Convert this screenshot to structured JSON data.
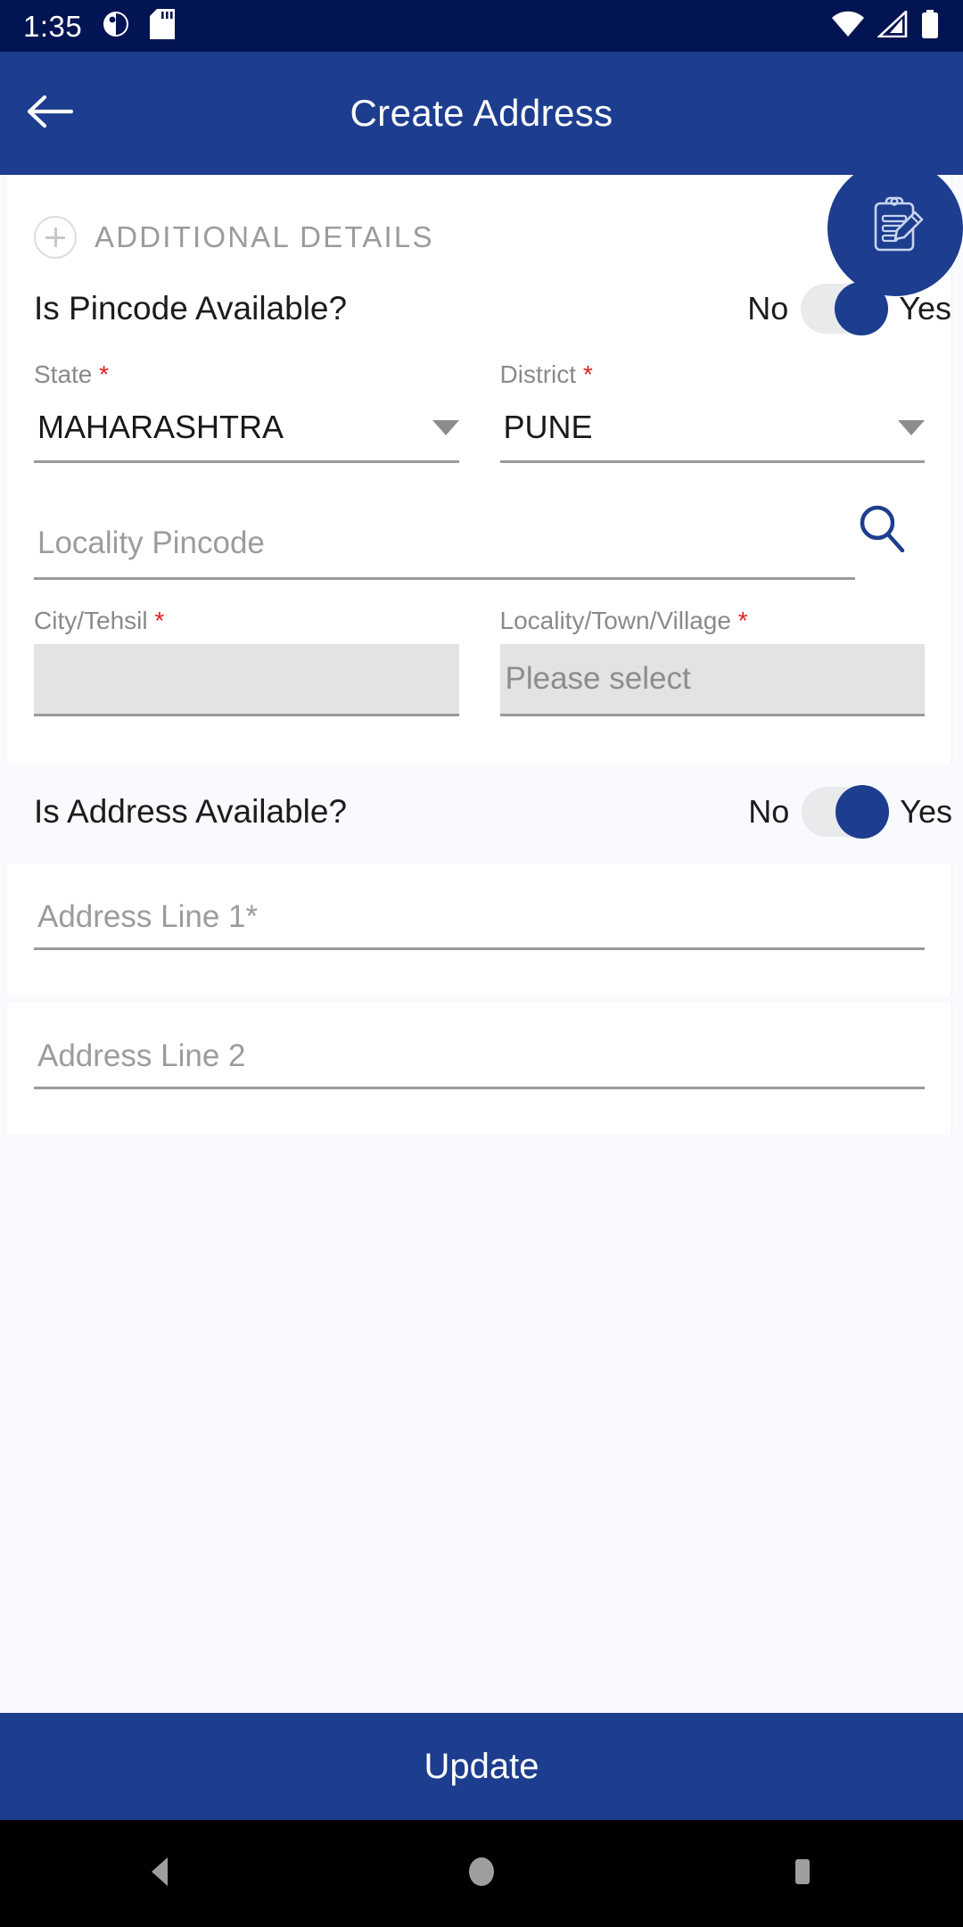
{
  "status_bar": {
    "time": "1:35",
    "icons": [
      "screenshot-icon",
      "sd-card-icon",
      "wifi-icon",
      "cellular-signal-icon",
      "battery-icon"
    ]
  },
  "app_bar": {
    "back_icon": "back-arrow-icon",
    "title": "Create Address"
  },
  "fab": {
    "icon": "clipboard-edit-icon"
  },
  "section": {
    "expand_icon": "plus-circle-icon",
    "title": "ADDITIONAL DETAILS"
  },
  "pincode_toggle": {
    "label": "Is Pincode Available?",
    "off_label": "No",
    "on_label": "Yes",
    "value": "Yes"
  },
  "state": {
    "label": "State",
    "required": "*",
    "value": "MAHARASHTRA",
    "caret_icon": "chevron-down-icon"
  },
  "district": {
    "label": "District",
    "required": "*",
    "value": "PUNE",
    "caret_icon": "chevron-down-icon"
  },
  "locality_pincode": {
    "placeholder": "Locality Pincode",
    "value": "",
    "search_icon": "search-icon"
  },
  "city_tehsil": {
    "label": "City/Tehsil",
    "required": "*",
    "value": ""
  },
  "locality_town_village": {
    "label": "Locality/Town/Village",
    "required": "*",
    "value": "Please select"
  },
  "address_toggle": {
    "label": "Is Address Available?",
    "off_label": "No",
    "on_label": "Yes",
    "value": "Yes"
  },
  "address_line_1": {
    "placeholder": "Address Line 1*",
    "value": ""
  },
  "address_line_2": {
    "placeholder": "Address Line 2",
    "value": ""
  },
  "update_button": {
    "label": "Update"
  },
  "nav_bar": {
    "back": "nav-back-icon",
    "home": "nav-home-icon",
    "recents": "nav-recents-icon"
  },
  "colors": {
    "status_bar": "#031452",
    "app_bar": "#1d3d8f",
    "accent": "#1d3d8f",
    "required": "#e02020",
    "page_bg": "#f8fafd"
  }
}
